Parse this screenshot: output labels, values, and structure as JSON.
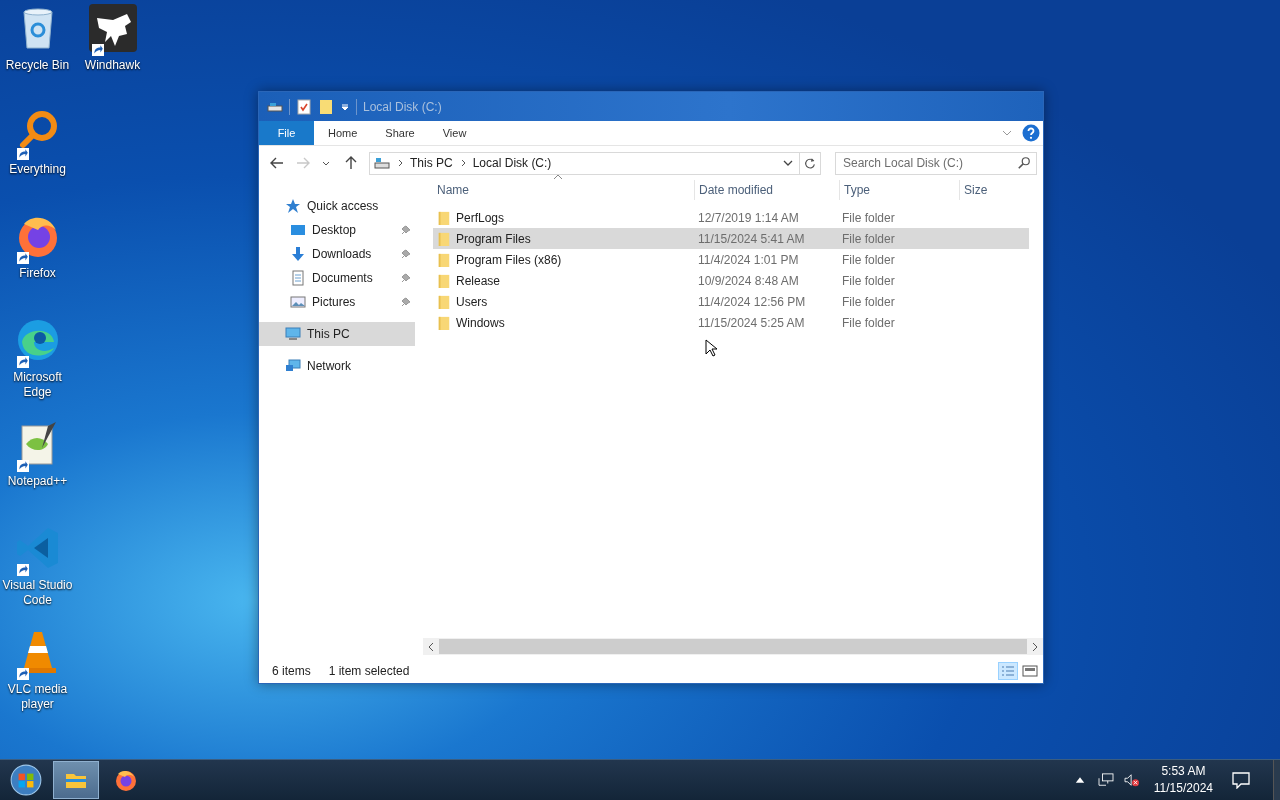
{
  "desktop_icons": [
    [
      {
        "label": "Recycle Bin",
        "kind": "recycle",
        "shortcut": false
      },
      {
        "label": "Everything",
        "kind": "everything",
        "shortcut": true
      },
      {
        "label": "Firefox",
        "kind": "firefox",
        "shortcut": true
      },
      {
        "label": "Microsoft Edge",
        "kind": "edge",
        "shortcut": true
      },
      {
        "label": "Notepad++",
        "kind": "notepad",
        "shortcut": true
      },
      {
        "label": "Visual Studio Code",
        "kind": "vscode",
        "shortcut": true
      },
      {
        "label": "VLC media player",
        "kind": "vlc",
        "shortcut": true
      }
    ],
    [
      {
        "label": "Windhawk",
        "kind": "windhawk",
        "shortcut": true
      }
    ]
  ],
  "window": {
    "title": "Local Disk (C:)",
    "ribbon_tabs": [
      {
        "label": "File",
        "kind": "file",
        "selected": false
      },
      {
        "label": "Home",
        "kind": "tab",
        "selected": false
      },
      {
        "label": "Share",
        "kind": "tab",
        "selected": false
      },
      {
        "label": "View",
        "kind": "tab",
        "selected": false
      }
    ],
    "breadcrumb": [
      "This PC",
      "Local Disk (C:)"
    ],
    "search": {
      "placeholder": "Search Local Disk (C:)"
    },
    "sidebar": [
      {
        "label": "Quick access",
        "kind": "star",
        "selected": false,
        "children": [
          {
            "label": "Desktop",
            "kind": "desktop",
            "pinned": true,
            "selected": false
          },
          {
            "label": "Downloads",
            "kind": "downloads",
            "pinned": true,
            "selected": false
          },
          {
            "label": "Documents",
            "kind": "documents",
            "pinned": true,
            "selected": false
          },
          {
            "label": "Pictures",
            "kind": "pictures",
            "pinned": true,
            "selected": false
          }
        ]
      },
      {
        "label": "This PC",
        "kind": "pc",
        "selected": true
      },
      {
        "label": "Network",
        "kind": "network",
        "selected": false
      }
    ],
    "columns": [
      "Name",
      "Date modified",
      "Type",
      "Size"
    ],
    "rows": [
      {
        "name": "PerfLogs",
        "date": "12/7/2019 1:14 AM",
        "type": "File folder",
        "selected": false
      },
      {
        "name": "Program Files",
        "date": "11/15/2024 5:41 AM",
        "type": "File folder",
        "selected": true
      },
      {
        "name": "Program Files (x86)",
        "date": "11/4/2024 1:01 PM",
        "type": "File folder",
        "selected": false
      },
      {
        "name": "Release",
        "date": "10/9/2024 8:48 AM",
        "type": "File folder",
        "selected": false
      },
      {
        "name": "Users",
        "date": "11/4/2024 12:56 PM",
        "type": "File folder",
        "selected": false
      },
      {
        "name": "Windows",
        "date": "11/15/2024 5:25 AM",
        "type": "File folder",
        "selected": false
      }
    ],
    "status_bar": {
      "count": "6 items",
      "selection": "1 item selected"
    }
  },
  "taskbar": {
    "apps": [
      {
        "kind": "explorer",
        "selected": true
      },
      {
        "kind": "firefox",
        "selected": false
      }
    ],
    "time": "5:53 AM",
    "date": "11/15/2024"
  }
}
